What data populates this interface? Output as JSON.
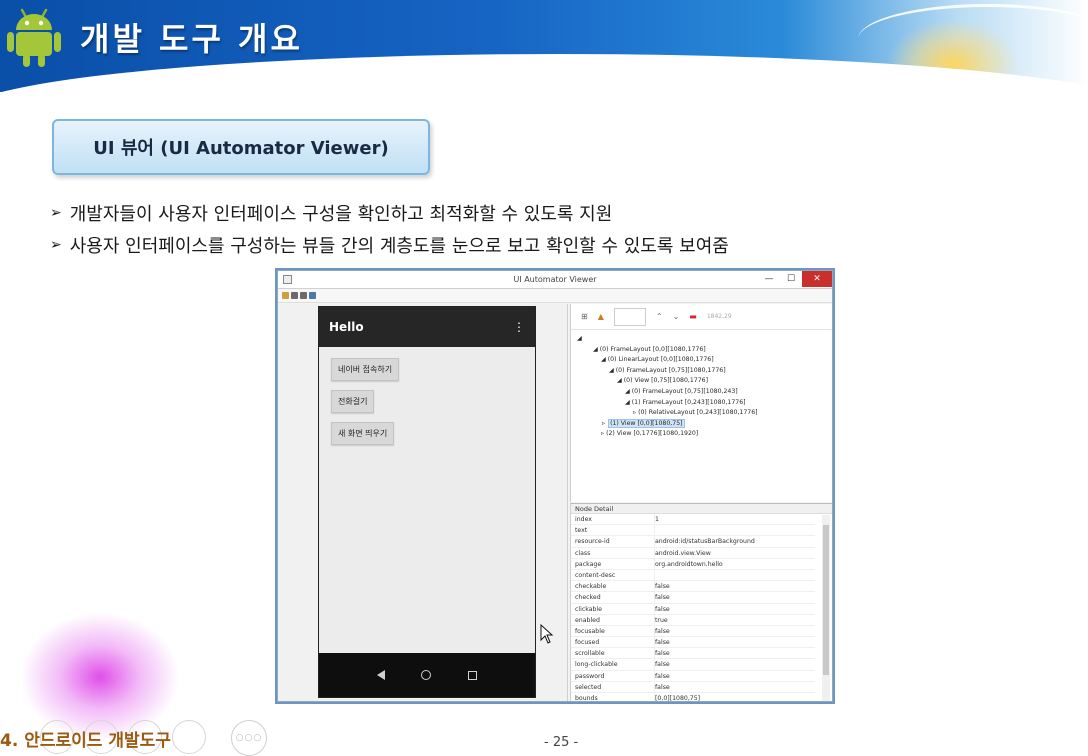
{
  "header": {
    "title": "개발 도구 개요"
  },
  "section": {
    "label": "UI 뷰어 (UI Automator Viewer)"
  },
  "bullets": [
    "개발자들이 사용자 인터페이스 구성을 확인하고 최적화할 수 있도록 지원",
    "사용자 인터페이스를 구성하는 뷰들 간의 계층도를 눈으로 보고 확인할 수 있도록 보여줌"
  ],
  "bullet_marker": "➢",
  "window": {
    "title": "UI Automator Viewer",
    "controls": [
      "—",
      "☐",
      "✕"
    ]
  },
  "phone": {
    "app_title": "Hello",
    "menu_glyph": "⋮",
    "buttons": [
      "네이버 접속하기",
      "전화걸기",
      "새 화면 띄우기"
    ]
  },
  "tree_toolbar": {
    "faint_text": "1842,29"
  },
  "tree": [
    "(0) FrameLayout [0,0][1080,1776]",
    "(0) LinearLayout [0,0][1080,1776]",
    "(0) FrameLayout [0,75][1080,1776]",
    "(0) View [0,75][1080,1776]",
    "(0) FrameLayout [0,75][1080,243]",
    "(1) FrameLayout [0,243][1080,1776]",
    "(0) RelativeLayout [0,243][1080,1776]",
    "(1) View [0,0][1080,75]",
    "(2) View [0,1776][1080,1920]"
  ],
  "tree_indent": [
    2,
    3,
    4,
    5,
    6,
    6,
    7,
    3,
    3
  ],
  "node_detail": {
    "heading": "Node Detail",
    "rows": [
      {
        "k": "index",
        "v": "1"
      },
      {
        "k": "text",
        "v": ""
      },
      {
        "k": "resource-id",
        "v": "android:id/statusBarBackground"
      },
      {
        "k": "class",
        "v": "android.view.View"
      },
      {
        "k": "package",
        "v": "org.androidtown.hello"
      },
      {
        "k": "content-desc",
        "v": ""
      },
      {
        "k": "checkable",
        "v": "false"
      },
      {
        "k": "checked",
        "v": "false"
      },
      {
        "k": "clickable",
        "v": "false"
      },
      {
        "k": "enabled",
        "v": "true"
      },
      {
        "k": "focusable",
        "v": "false"
      },
      {
        "k": "focused",
        "v": "false"
      },
      {
        "k": "scrollable",
        "v": "false"
      },
      {
        "k": "long-clickable",
        "v": "false"
      },
      {
        "k": "password",
        "v": "false"
      },
      {
        "k": "selected",
        "v": "false"
      },
      {
        "k": "bounds",
        "v": "[0,0][1080,75]"
      }
    ]
  },
  "footer": {
    "chapter": "4. 안드로이드 개발도구",
    "page": "- 25 -",
    "dots": "○○○"
  },
  "colors": {
    "banner_blue": "#1664c4",
    "chapter_text": "#9a5a10",
    "android_green": "#a4c639"
  }
}
